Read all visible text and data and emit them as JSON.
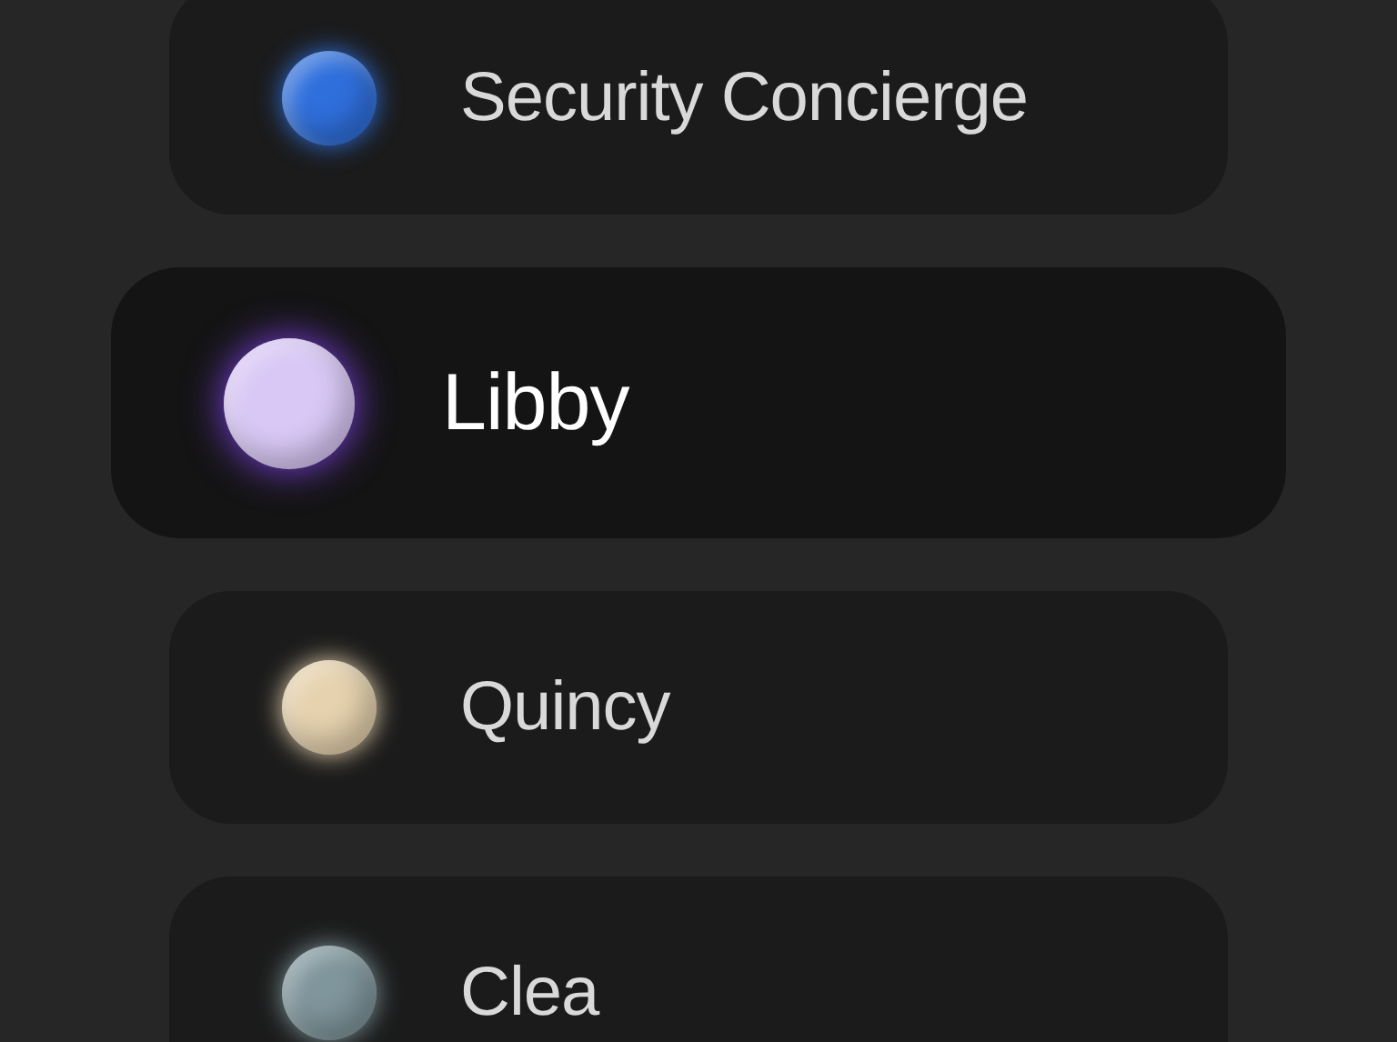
{
  "assistants": [
    {
      "name": "Security Concierge",
      "color": "#2f6fdc",
      "selected": false
    },
    {
      "name": "Libby",
      "color": "#d9c8f5",
      "selected": true
    },
    {
      "name": "Quincy",
      "color": "#e6d2ae",
      "selected": false
    },
    {
      "name": "Clea",
      "color": "#7f969c",
      "selected": false
    }
  ]
}
